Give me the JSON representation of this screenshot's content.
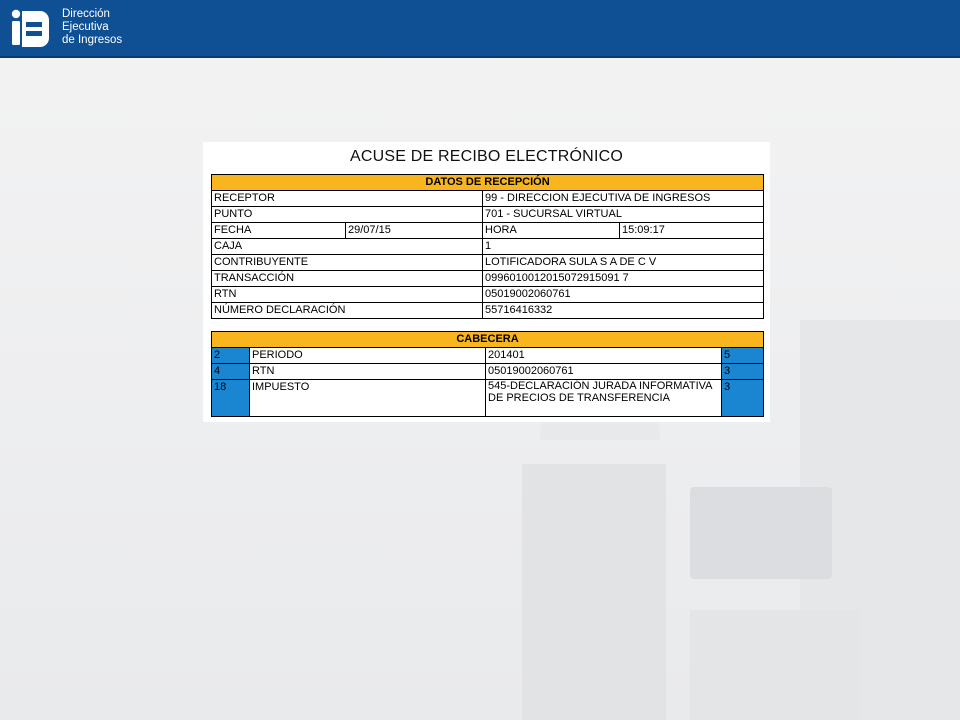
{
  "header": {
    "brand_line1": "Dirección",
    "brand_line2": "Ejecutiva",
    "brand_line3": "de Ingresos",
    "bg_color": "#0f4f94"
  },
  "document": {
    "title": "ACUSE DE RECIBO ELECTRÓNICO",
    "reception": {
      "header": "DATOS DE RECEPCIÓN",
      "receptor_label": "RECEPTOR",
      "receptor_value": "99 - DIRECCION EJECUTIVA DE INGRESOS",
      "punto_label": "PUNTO",
      "punto_value": "701 - SUCURSAL VIRTUAL",
      "fecha_label": "FECHA",
      "fecha_value": "29/07/15",
      "hora_label": "HORA",
      "hora_value": "15:09:17",
      "caja_label": "CAJA",
      "caja_value": "1",
      "contribuyente_label": "CONTRIBUYENTE",
      "contribuyente_value": "LOTIFICADORA SULA S A DE C V",
      "transaccion_label": "TRANSACCIÓN",
      "transaccion_value": "0996010012015072915091 7",
      "rtn_label": "RTN",
      "rtn_value": "05019002060761",
      "numero_label": "NÚMERO DECLARACIÓN",
      "numero_value": "55716416332"
    },
    "cabecera": {
      "header": "CABECERA",
      "rows": [
        {
          "code": "2",
          "label": "PERIODO",
          "value": "201401",
          "extra": "5"
        },
        {
          "code": "4",
          "label": "RTN",
          "value": "05019002060761",
          "extra": "3"
        },
        {
          "code": "18",
          "label": "IMPUESTO",
          "value": "545-DECLARACIÓN JURADA INFORMATIVA DE PRECIOS DE TRANSFERENCIA",
          "extra": "3"
        }
      ]
    },
    "colors": {
      "header_fill": "#f9b51e",
      "code_fill": "#1a86d2"
    }
  }
}
